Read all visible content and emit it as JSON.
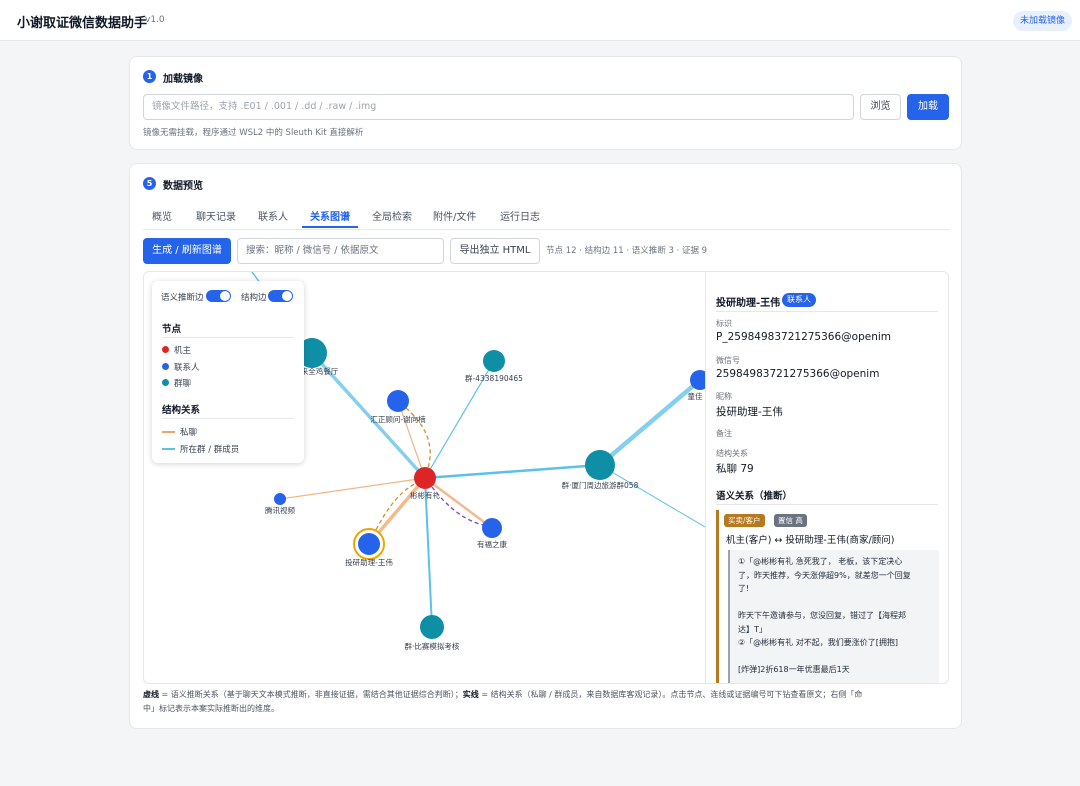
{
  "header": {
    "title": "小谢取证微信数据助手",
    "version": "v1.0",
    "status": "未加载镜像"
  },
  "load_card": {
    "step": "1",
    "title": "加载镜像",
    "placeholder": "镜像文件路径，支持 .E01 / .001 / .dd / .raw / .img",
    "browse": "浏览",
    "load": "加载",
    "hint": "镜像无需挂载，程序通过 WSL2 中的 Sleuth Kit 直接解析"
  },
  "preview_card": {
    "step": "5",
    "title": "数据预览",
    "tabs": [
      "概览",
      "聊天记录",
      "联系人",
      "关系图谱",
      "全局检索",
      "附件/文件",
      "运行日志"
    ],
    "active_tab": "关系图谱",
    "generate": "生成 / 刷新图谱",
    "search_placeholder": "搜索：昵称 / 微信号 / 依据原文",
    "export": "导出独立 HTML",
    "stats": "节点 12 · 结构边 11 · 语义推断 3 · 证据 9"
  },
  "legend": {
    "toggle_semantic": "语义推断边",
    "toggle_structural": "结构边",
    "nodes_title": "节点",
    "node_types": [
      {
        "label": "机主",
        "color": "#dc2626"
      },
      {
        "label": "联系人",
        "color": "#2563eb"
      },
      {
        "label": "群聊",
        "color": "#0e8fa6"
      }
    ],
    "structure_title": "结构关系",
    "edge_types": [
      {
        "label": "私聊",
        "color": "#f0a366"
      },
      {
        "label": "所在群 / 群成员",
        "color": "#5bc0eb"
      }
    ]
  },
  "graph": {
    "owner": "彬彬有礼",
    "nodes": {
      "canteen": "漳州来全鸡餐厅",
      "group_433": "群-4338190465",
      "advisor": "汇正顾问-谢向楠",
      "tour_group": "群·厦门周边旅游群058",
      "tencent": "腾讯视频",
      "selected": "投研助理-王伟",
      "youfu": "有福之康",
      "exam_group": "群·比赛模拟考核",
      "partial": "童佳"
    }
  },
  "detail": {
    "name": "投研助理-王伟",
    "badge": "联系人",
    "fields": [
      {
        "label": "标识",
        "value": "P_25984983721275366@openim"
      },
      {
        "label": "微信号",
        "value": "25984983721275366@openim"
      },
      {
        "label": "昵称",
        "value": "投研助理-王伟"
      },
      {
        "label": "备注",
        "value": ""
      },
      {
        "label": "结构关系",
        "value": "私聊 79"
      }
    ],
    "semantic_title": "语义关系（推断）",
    "semantic": {
      "tag": "买卖/客户",
      "tag_color": "#b7791f",
      "confidence": "置信 高",
      "relation": "机主(客户) ↔ 投研助理-王伟(商家/顾问)",
      "evidence_lines": [
        "①「@彬彬有礼 急死我了， 老板，该下定决心",
        "了，昨天推荐，今天涨停超9%，就差您一个回复",
        "了!",
        "",
        "昨天下午邀请参与，您没回复，错过了【海程邦",
        "达】T」",
        "②「@彬彬有礼 对不起，我们要涨价了[拥抱]",
        "",
        "[炸弹]2折618一年优惠最后1天"
      ]
    }
  },
  "footnote": {
    "dashed_label": "虚线",
    "dashed_text": " = 语义推断关系（基于聊天文本模式推断，非直接证据，需结合其他证据综合判断）；",
    "solid_label": "实线",
    "solid_text": " = 结构关系（私聊 / 群成员，来自数据库客观记录）。点击节点、连线或证据编号可下钻查看原文；右侧「命",
    "line2": "中」标记表示本案实际推断出的维度。"
  }
}
